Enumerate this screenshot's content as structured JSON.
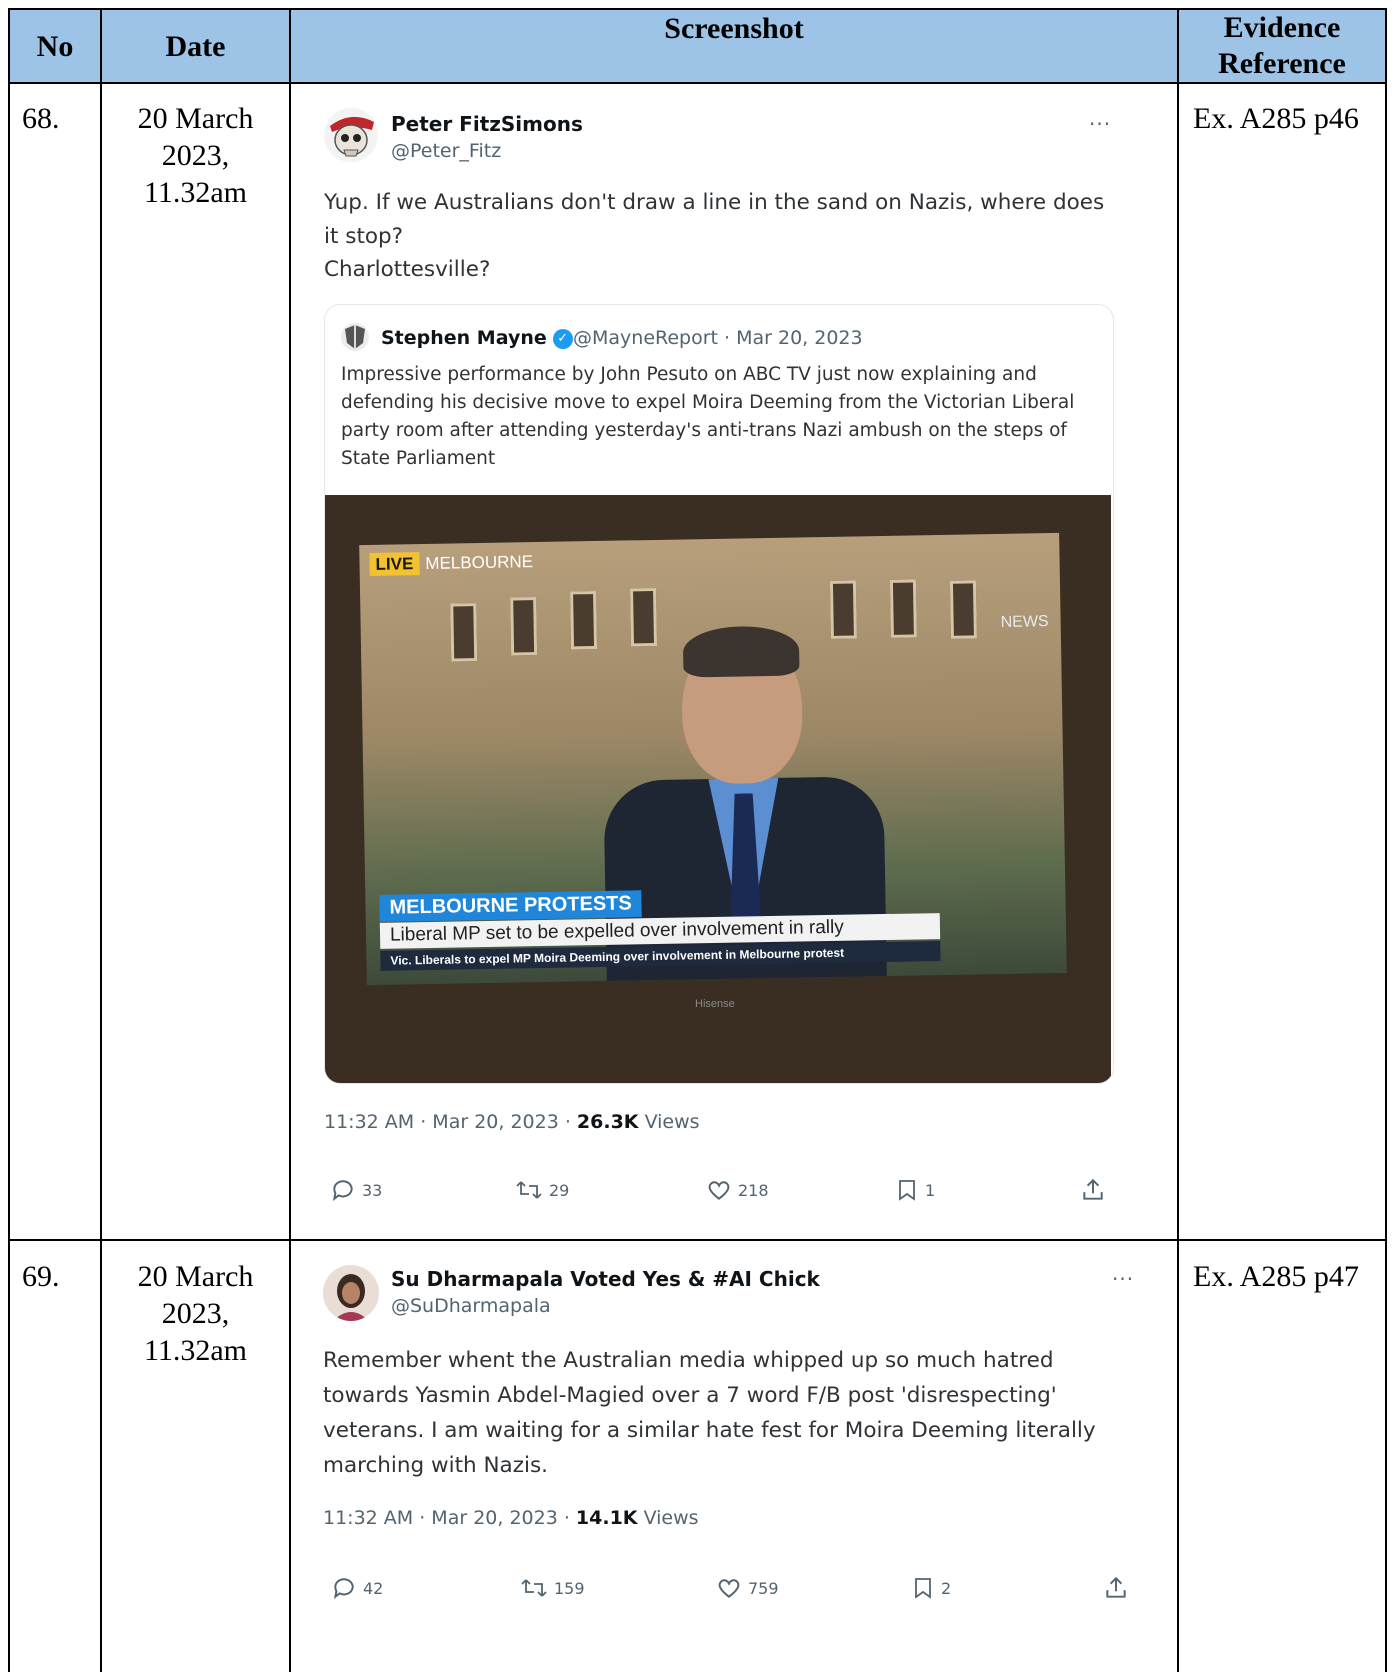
{
  "table": {
    "headers": {
      "no": "No",
      "date": "Date",
      "screenshot": "Screenshot",
      "evidence_line1": "Evidence",
      "evidence_line2": "Reference"
    },
    "rows": [
      {
        "no": "68.",
        "date_line1": "20 March",
        "date_line2": "2023,",
        "date_line3": "11.32am",
        "evidence": "Ex. A285 p46",
        "tweet": {
          "author_name": "Peter FitzSimons",
          "author_handle": "@Peter_Fitz",
          "more": "···",
          "text_line1": "Yup. If we Australians don't draw a line in the sand on Nazis, where does",
          "text_line2": "it stop?",
          "text_line3": "Charlottesville?",
          "quote": {
            "author_name": "Stephen Mayne",
            "author_handle_date": "@MayneReport · Mar 20, 2023",
            "text_line1": "Impressive performance by John Pesuto on ABC TV just now explaining and",
            "text_line2": "defending his decisive move to expel Moira Deeming from the Victorian Liberal",
            "text_line3": "party room after attending yesterday's anti-trans Nazi ambush on the steps of",
            "text_line4": "State Parliament",
            "image": {
              "live": "LIVE",
              "location": "MELBOURNE",
              "news_logo": "NEWS",
              "headline": "MELBOURNE PROTESTS",
              "subheadline": "Liberal MP set to be expelled over involvement in rally",
              "ticker": "Vic. Liberals to expel MP Moira Deeming over involvement in Melbourne protest",
              "tv_brand": "Hisense"
            }
          },
          "time_date": "11:32 AM · Mar 20, 2023 · ",
          "views_count": "26.3K",
          "views_label": " Views",
          "replies": "33",
          "retweets": "29",
          "likes": "218",
          "bookmarks": "1"
        }
      },
      {
        "no": "69.",
        "date_line1": "20 March",
        "date_line2": "2023,",
        "date_line3": "11.32am",
        "evidence": "Ex. A285 p47",
        "tweet": {
          "author_name": "Su Dharmapala Voted Yes & #AI Chick",
          "author_handle": "@SuDharmapala",
          "more": "···",
          "text_line1": "Remember whent the Australian media whipped up so much hatred",
          "text_line2": "towards Yasmin Abdel-Magied over a 7 word F/B post 'disrespecting'",
          "text_line3": "veterans. I am waiting for a similar hate fest for Moira Deeming literally",
          "text_line4": "marching with Nazis.",
          "time_date": "11:32 AM · Mar 20, 2023 · ",
          "views_count": "14.1K",
          "views_label": " Views",
          "replies": "42",
          "retweets": "159",
          "likes": "759",
          "bookmarks": "2"
        }
      }
    ]
  },
  "colors": {
    "header_bg": "#9dc3e6",
    "muted_text": "#536471",
    "verified_blue": "#1d9bf0"
  }
}
